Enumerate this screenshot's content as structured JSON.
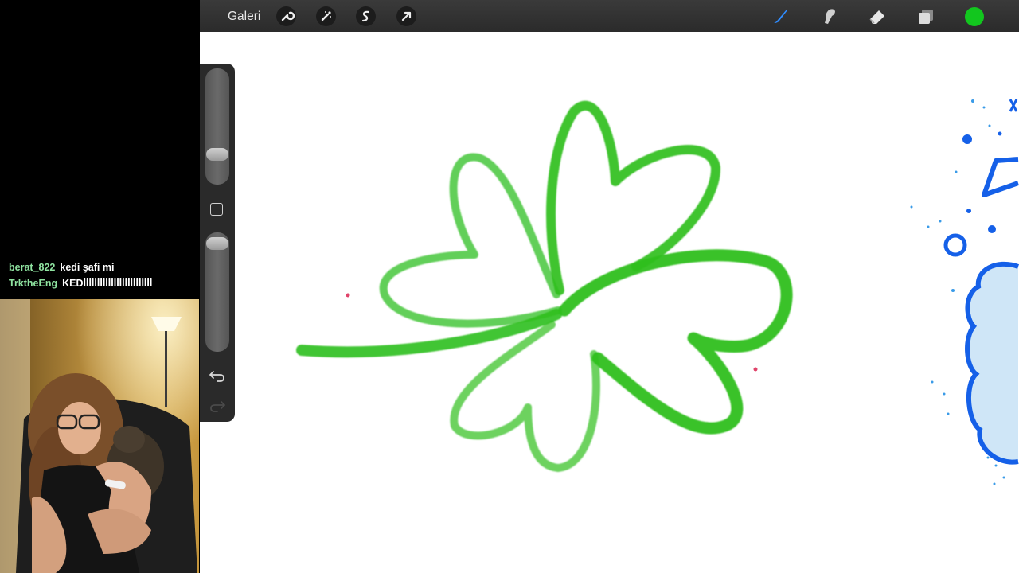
{
  "chat": {
    "messages": [
      {
        "user": "berat_822",
        "text": "kedi şafi mi"
      },
      {
        "user": "TrktheEng",
        "text": "KEDİİİİİİİİİİİİİİİİİİİİİİİİİ"
      }
    ]
  },
  "toolbar": {
    "gallery_label": "Galeri",
    "left_tools": [
      "wrench-icon",
      "magic-wand-icon",
      "selection-icon",
      "transform-arrow-icon"
    ],
    "right_tools": [
      "brush-icon",
      "smudge-icon",
      "eraser-icon",
      "layers-icon"
    ],
    "current_color": "#12c61e"
  },
  "canvas": {
    "stroke_color": "#2fbf1f",
    "accent_blue": "#1560e8"
  }
}
